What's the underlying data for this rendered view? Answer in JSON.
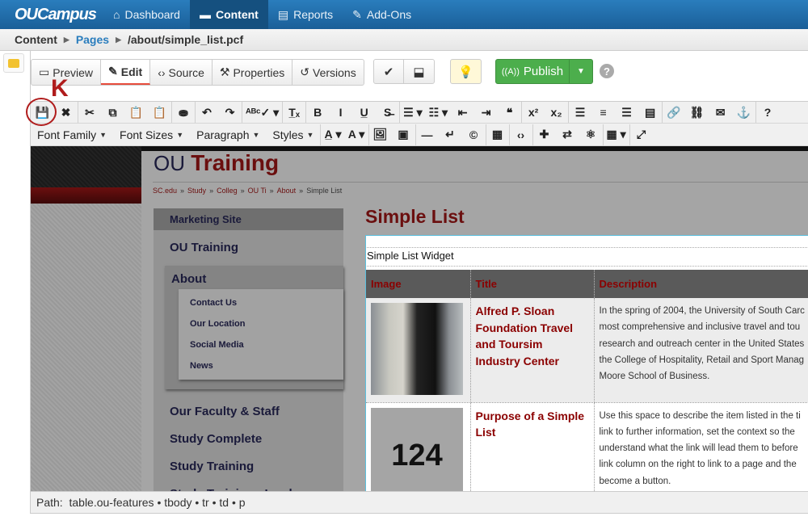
{
  "app": {
    "logo": "OUCampus"
  },
  "nav": [
    {
      "label": "Dashboard",
      "icon": "⌂"
    },
    {
      "label": "Content",
      "icon": "▬"
    },
    {
      "label": "Reports",
      "icon": "▤"
    },
    {
      "label": "Add-Ons",
      "icon": "✎"
    }
  ],
  "breadcrumb": {
    "root": "Content",
    "pages": "Pages",
    "file": "/about/simple_list.pcf",
    "sep": "▶"
  },
  "tabs": [
    {
      "label": "Preview",
      "icon": "▭"
    },
    {
      "label": "Edit",
      "icon": "✎"
    },
    {
      "label": "Source",
      "icon": "‹›"
    },
    {
      "label": "Properties",
      "icon": "⚒"
    },
    {
      "label": "Versions",
      "icon": "↺"
    }
  ],
  "actions": {
    "check": "✔",
    "save_version": "⬓",
    "bulb": "💡",
    "publish": "Publish",
    "publish_icon": "((A))",
    "publish_caret": "▼",
    "help": "?"
  },
  "annotation": {
    "letter": "K"
  },
  "toolbar1": [
    {
      "name": "save",
      "g": "💾"
    },
    {
      "name": "cancel",
      "g": "✖"
    },
    {
      "name": "cut",
      "g": "✂",
      "sep": 1
    },
    {
      "name": "copy",
      "g": "⧉"
    },
    {
      "name": "paste",
      "g": "📋"
    },
    {
      "name": "paste-text",
      "g": "📋"
    },
    {
      "name": "find",
      "g": "⛂",
      "sep": 1
    },
    {
      "name": "undo",
      "g": "↶",
      "sep": 1
    },
    {
      "name": "redo",
      "g": "↷"
    },
    {
      "name": "spellcheck",
      "g": "ᴬᴮᶜ✓ ▾",
      "sep": 1
    },
    {
      "name": "clear-formatting",
      "g": "T̲ₓ",
      "sep": 1
    },
    {
      "name": "bold",
      "g": "B",
      "sep": 1
    },
    {
      "name": "italic",
      "g": "I"
    },
    {
      "name": "underline",
      "g": "U̲"
    },
    {
      "name": "strikethrough",
      "g": "S̶"
    },
    {
      "name": "bullet-list",
      "g": "☰ ▾",
      "sep": 1
    },
    {
      "name": "numbered-list",
      "g": "☷ ▾"
    },
    {
      "name": "outdent",
      "g": "⇤"
    },
    {
      "name": "indent",
      "g": "⇥"
    },
    {
      "name": "blockquote",
      "g": "❝"
    },
    {
      "name": "superscript",
      "g": "x²",
      "sep": 1
    },
    {
      "name": "subscript",
      "g": "x₂"
    },
    {
      "name": "align-left",
      "g": "☰",
      "sep": 1
    },
    {
      "name": "align-center",
      "g": "≡"
    },
    {
      "name": "align-right",
      "g": "☰"
    },
    {
      "name": "justify",
      "g": "▤"
    },
    {
      "name": "link",
      "g": "🔗",
      "sep": 1
    },
    {
      "name": "unlink",
      "g": "⛓"
    },
    {
      "name": "email",
      "g": "✉"
    },
    {
      "name": "anchor",
      "g": "⚓"
    },
    {
      "name": "help",
      "g": "?",
      "sep": 1
    }
  ],
  "toolbar2": [
    {
      "name": "font-family",
      "g": "Font Family",
      "drop": 1
    },
    {
      "name": "font-sizes",
      "g": "Font Sizes",
      "drop": 1
    },
    {
      "name": "paragraph",
      "g": "Paragraph",
      "drop": 1
    },
    {
      "name": "styles",
      "g": "Styles",
      "drop": 1
    },
    {
      "name": "text-color",
      "g": "A̲ ▾",
      "sep": 1
    },
    {
      "name": "background-color",
      "g": "A ▾"
    },
    {
      "name": "image",
      "g": "🖼",
      "sep": 1
    },
    {
      "name": "media",
      "g": "▣"
    },
    {
      "name": "horizontal-rule",
      "g": "—",
      "sep": 1
    },
    {
      "name": "line-break",
      "g": "↵"
    },
    {
      "name": "copyright",
      "g": "©"
    },
    {
      "name": "template",
      "g": "▦",
      "sep": 1
    },
    {
      "name": "code",
      "g": "‹›",
      "sep": 1
    },
    {
      "name": "plugin",
      "g": "✚",
      "sep": 1
    },
    {
      "name": "replace",
      "g": "⇄"
    },
    {
      "name": "gadget",
      "g": "⚛"
    },
    {
      "name": "table",
      "g": "▦ ▾",
      "sep": 1
    },
    {
      "name": "fullscreen",
      "g": "⤢",
      "sep": 1
    }
  ],
  "site": {
    "title_light": "OU",
    "title_bold": "Training",
    "crumbs": [
      "SC.edu",
      "Study",
      "Colleɡ",
      "OU Ti",
      "About",
      "Simple List"
    ],
    "crumb_sep": "»",
    "sidenav": {
      "head": "Marketing Site",
      "top": "OU Training",
      "about": "About",
      "sub": [
        "Contact Us",
        "Our Location",
        "Social Media",
        "News"
      ],
      "more": [
        "Our Faculty & Staff",
        "Study Complete",
        "Study Training",
        "Study Training - Ivanka"
      ]
    },
    "page_title": "Simple List",
    "widget_caption": "Simple List Widget",
    "table": {
      "headers": [
        "Image",
        "Title",
        "Description"
      ],
      "rows": [
        {
          "image": "photo",
          "title": "Alfred P. Sloan Foundation Travel and Toursim Industry Center",
          "desc": [
            "In the spring of 2004, the University of South Carc",
            "most comprehensive and inclusive travel and tou",
            "research and outreach center in the United States",
            "the College of Hospitality, Retail and Sport Manag",
            "Moore School of Business."
          ]
        },
        {
          "image": "124",
          "title": "Purpose of a Simple List",
          "desc": [
            "Use this space to describe the item listed in the ti",
            "link to further information, set the context so the",
            "understand what the link will lead them to before",
            "link column on the right to link to a page and the",
            "become a button."
          ]
        }
      ]
    }
  },
  "pathbar": {
    "label": "Path:",
    "path": "table.ou-features • tbody • tr • td • p"
  }
}
